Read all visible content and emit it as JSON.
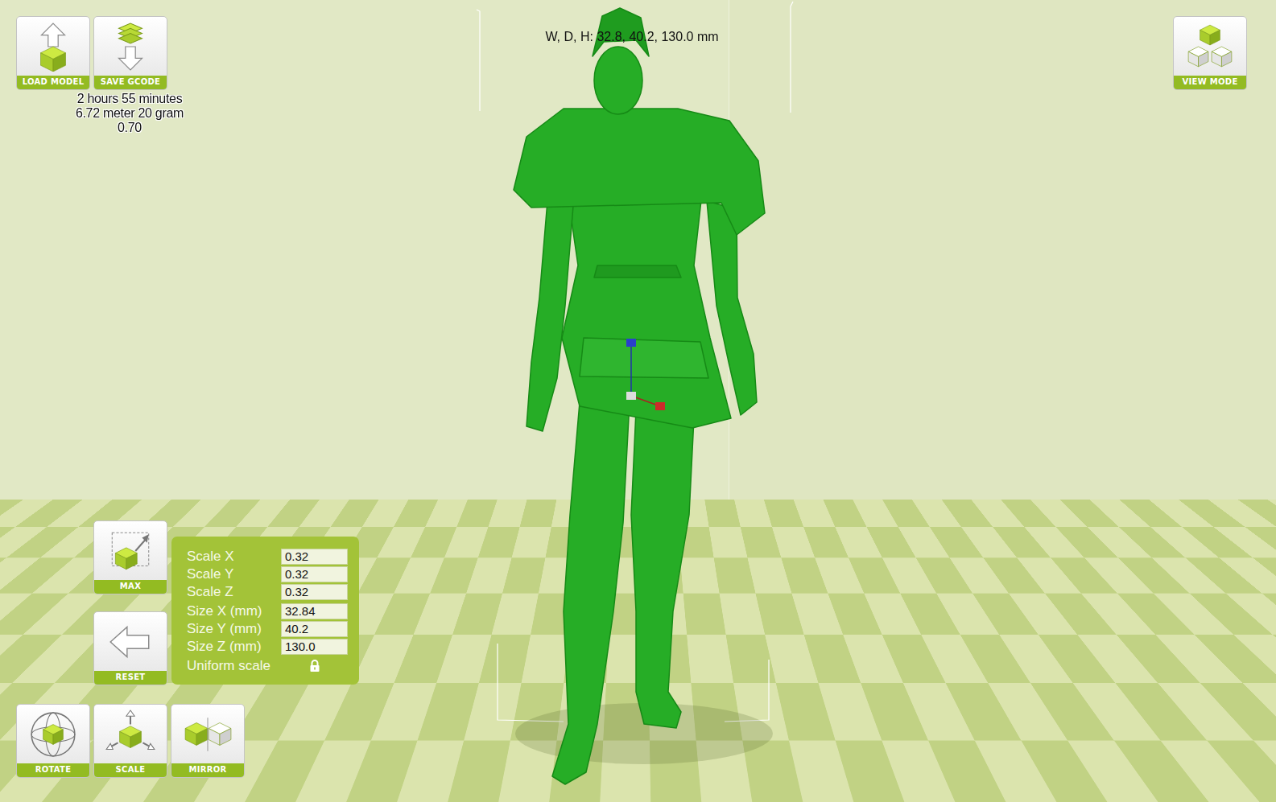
{
  "toolbar": [
    "LOAD MODEL",
    "SAVE GCODE"
  ],
  "print_info": [
    "2 hours 55 minutes",
    "6.72 meter 20 gram",
    "0.70"
  ],
  "dimensions": "W, D, H: 32.8, 40.2, 130.0 mm",
  "view_mode": "VIEW MODE",
  "scale_buttons": {
    "max": "MAX",
    "reset": "RESET"
  },
  "scale_panel": {
    "fields": [
      {
        "label": "Scale X",
        "value": "0.32"
      },
      {
        "label": "Scale Y",
        "value": "0.32"
      },
      {
        "label": "Scale Z",
        "value": "0.32"
      },
      {
        "label": "Size X (mm)",
        "value": "32.84"
      },
      {
        "label": "Size Y (mm)",
        "value": "40.2"
      },
      {
        "label": "Size Z (mm)",
        "value": "130.0"
      }
    ],
    "uniform_scale": {
      "label": "Uniform scale",
      "locked": true
    }
  },
  "tools": [
    "ROTATE",
    "SCALE",
    "MIRROR"
  ]
}
